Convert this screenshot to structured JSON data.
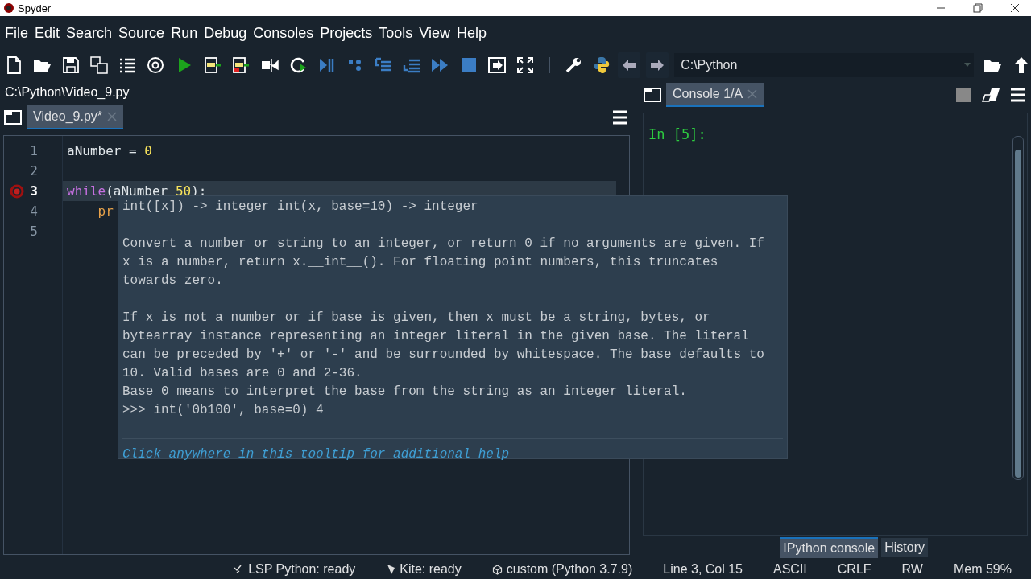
{
  "window": {
    "title": "Spyder"
  },
  "menu": [
    "File",
    "Edit",
    "Search",
    "Source",
    "Run",
    "Debug",
    "Consoles",
    "Projects",
    "Tools",
    "View",
    "Help"
  ],
  "toolbar": {
    "path": "C:\\Python"
  },
  "editor": {
    "file_path": "C:\\Python\\Video_9.py",
    "tabs": [
      {
        "label": "Video_9.py*",
        "selected": true
      }
    ],
    "lines": [
      {
        "number": "1",
        "current": false,
        "breakpoint": false,
        "tokens": [
          {
            "kind": "plain",
            "text": "aNumber = "
          },
          {
            "kind": "number",
            "text": "0"
          }
        ]
      },
      {
        "number": "2",
        "current": false,
        "breakpoint": false
      },
      {
        "number": "3",
        "current": true,
        "breakpoint": true,
        "tokens": [
          {
            "kind": "keyword",
            "text": "while"
          },
          {
            "kind": "plain",
            "text": "(aNumber "
          },
          {
            "kind": "number",
            "text": "50"
          },
          {
            "kind": "plain",
            "text": "):"
          }
        ]
      },
      {
        "number": "4",
        "current": false,
        "breakpoint": false,
        "tokens": [
          {
            "kind": "call",
            "text": "    pr"
          }
        ]
      },
      {
        "number": "5",
        "current": false,
        "breakpoint": false
      }
    ]
  },
  "tooltip": {
    "signature": "int([x]) -> integer int(x, base=10) -> integer",
    "paragraphs": [
      "Convert a number or string to an integer, or return 0 if no arguments are given. If\nx is a number, return x.__int__(). For floating point numbers, this truncates\ntowards zero.",
      "If x is not a number or if base is given, then x must be a string, bytes, or\nbytearray instance representing an integer literal in the given base. The literal\ncan be preceded by '+' or '-' and be surrounded by whitespace. The base defaults to\n10. Valid bases are 0 and 2-36.\nBase 0 means to interpret the base from the string as an integer literal.\n>>> int('0b100', base=0) 4"
    ],
    "link": "Click anywhere in this tooltip for additional help"
  },
  "console": {
    "tabs": [
      {
        "label": "Console 1/A",
        "selected": true
      }
    ],
    "prompt": "In [5]:",
    "bottom_tabs": [
      {
        "label": "IPython console",
        "selected": true
      },
      {
        "label": "History",
        "selected": false
      }
    ]
  },
  "status_bar": [
    {
      "kind": "lsp",
      "text": "LSP Python: ready"
    },
    {
      "kind": "kite",
      "text": "Kite: ready"
    },
    {
      "kind": "env",
      "text": "custom (Python 3.7.9)"
    },
    {
      "kind": "plain",
      "text": "Line 3, Col 15"
    },
    {
      "kind": "plain",
      "text": "ASCII"
    },
    {
      "kind": "plain",
      "text": "CRLF"
    },
    {
      "kind": "plain",
      "text": "RW"
    },
    {
      "kind": "plain",
      "text": "Mem 59%"
    }
  ]
}
